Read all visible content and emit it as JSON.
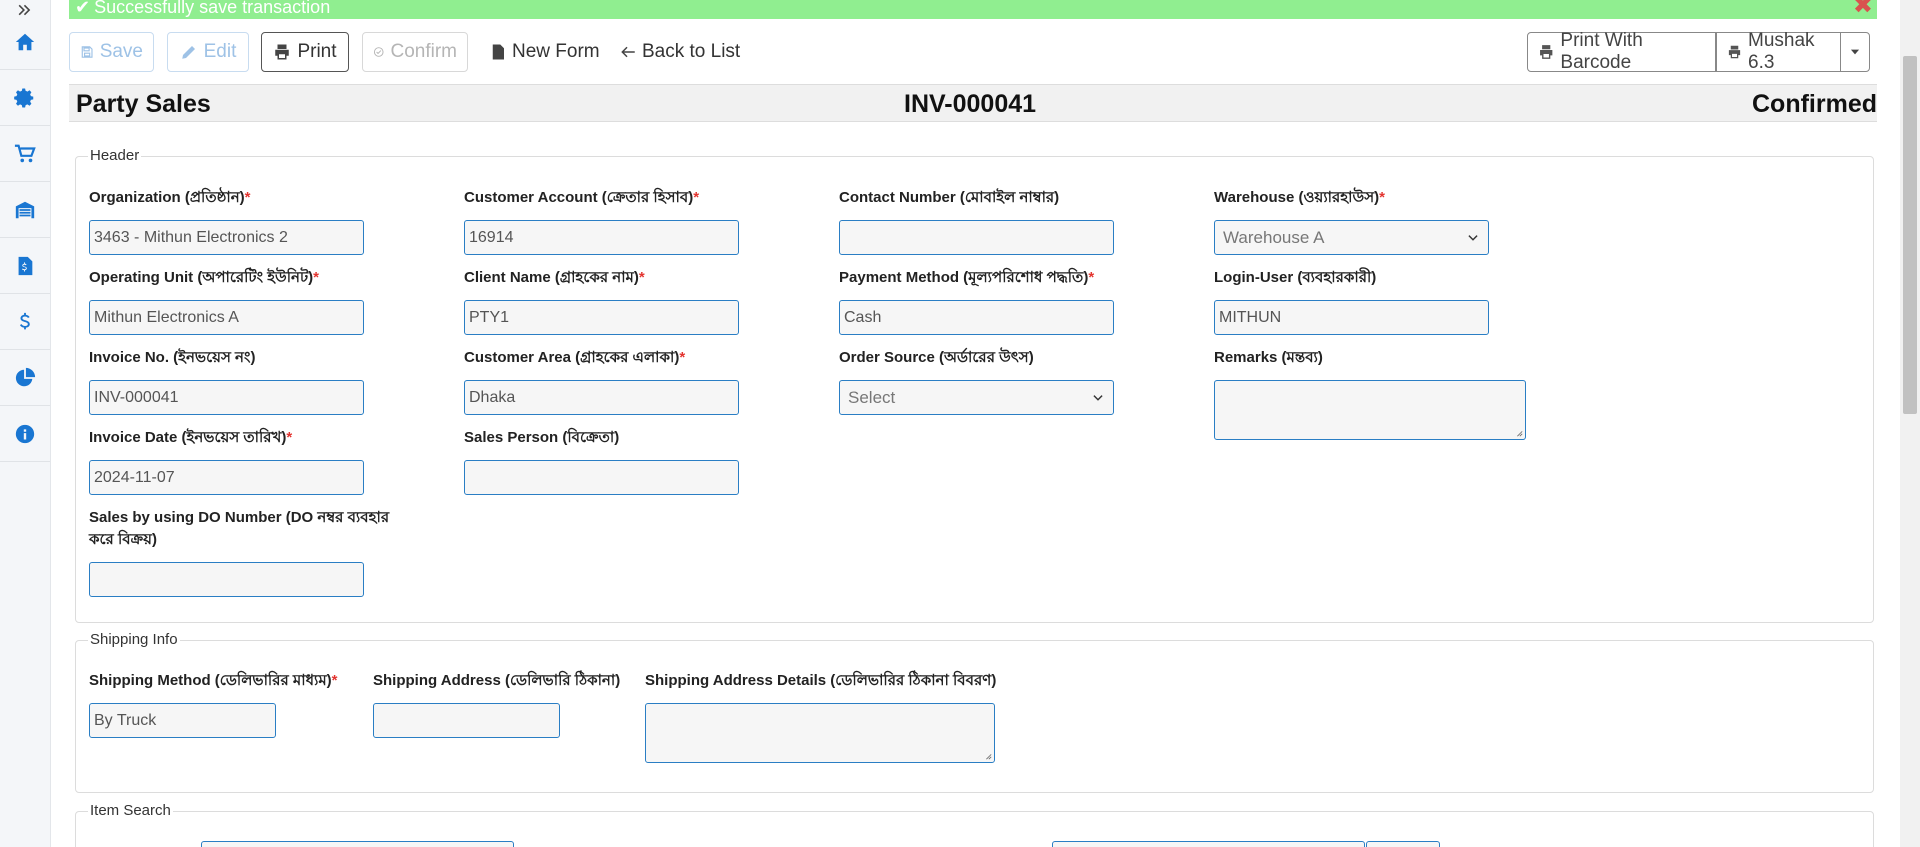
{
  "alert": {
    "message": "Successfully save transaction",
    "close": "✖"
  },
  "toolbar": {
    "save": "Save",
    "edit": "Edit",
    "print": "Print",
    "confirm": "Confirm",
    "new_form": "New Form",
    "back": "Back to List",
    "print_barcode": "Print With Barcode",
    "mushak": "Mushak 6.3"
  },
  "title": {
    "left": "Party Sales",
    "invoice": "INV-000041",
    "status": "Confirmed"
  },
  "header": {
    "legend": "Header",
    "organization": {
      "label": "Organization (প্রতিষ্ঠান)",
      "value": "3463 - Mithun Electronics 2"
    },
    "customer_account": {
      "label": "Customer Account (ক্রেতার হিসাব)",
      "value": "16914"
    },
    "contact_number": {
      "label": "Contact Number (মোবাইল নাম্বার)",
      "value": ""
    },
    "warehouse": {
      "label": "Warehouse (ওয়্যারহাউস)",
      "value": "Warehouse A"
    },
    "operating_unit": {
      "label": "Operating Unit (অপারেটিং ইউনিট)",
      "value": "Mithun Electronics A"
    },
    "client_name": {
      "label": "Client Name (গ্রাহকের নাম)",
      "value": "PTY1"
    },
    "payment_method": {
      "label": "Payment Method (মূল্যপরিশোধ পদ্ধতি)",
      "value": "Cash"
    },
    "login_user": {
      "label": "Login-User (ব্যবহারকারী)",
      "value": "MITHUN"
    },
    "invoice_no": {
      "label": "Invoice No. (ইনভয়েস নং)",
      "value": "INV-000041"
    },
    "customer_area": {
      "label": "Customer Area (গ্রাহকের এলাকা)",
      "value": "Dhaka"
    },
    "order_source": {
      "label": "Order Source (অর্ডারের উৎস)",
      "value": "Select"
    },
    "remarks": {
      "label": "Remarks (মন্তব্য)",
      "value": ""
    },
    "invoice_date": {
      "label": "Invoice Date (ইনভয়েস তারিখ)",
      "value": "2024-11-07"
    },
    "sales_person": {
      "label": "Sales Person (বিক্রেতা)",
      "value": ""
    },
    "do_number": {
      "label_line1": "Sales by using DO Number (DO নম্বর ব্যবহার",
      "label_line2": "করে বিক্রয়)",
      "value": ""
    }
  },
  "shipping": {
    "legend": "Shipping Info",
    "method": {
      "label": "Shipping Method (ডেলিভারির মাধ্যম)",
      "value": "By Truck"
    },
    "address": {
      "label": "Shipping Address (ডেলিভারি ঠিকানা)",
      "value": ""
    },
    "address_details": {
      "label": "Shipping Address Details (ডেলিভারির ঠিকানা বিবরণ)",
      "value": ""
    }
  },
  "item_search": {
    "legend": "Item Search"
  },
  "required_mark": "*",
  "icons": [
    "chevrons-right-icon",
    "home-icon",
    "gear-icon",
    "cart-icon",
    "warehouse-icon",
    "invoice-icon",
    "dollar-icon",
    "pie-chart-icon",
    "info-icon"
  ]
}
